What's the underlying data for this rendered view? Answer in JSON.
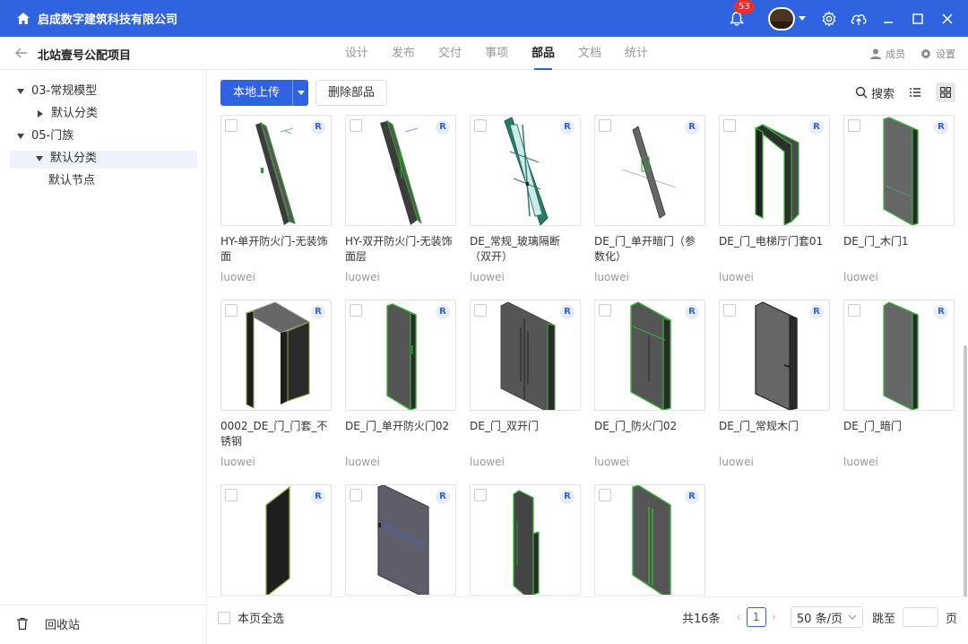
{
  "titlebar": {
    "app_title": "启成数字建筑科技有限公司",
    "notification_count": "53"
  },
  "nav": {
    "project_title": "北站壹号公配项目",
    "tabs": [
      {
        "label": "设计",
        "active": false
      },
      {
        "label": "发布",
        "active": false
      },
      {
        "label": "交付",
        "active": false
      },
      {
        "label": "事项",
        "active": false
      },
      {
        "label": "部品",
        "active": true
      },
      {
        "label": "文档",
        "active": false
      },
      {
        "label": "统计",
        "active": false
      }
    ],
    "members_label": "成员",
    "settings_label": "设置"
  },
  "sidebar": {
    "tree": [
      {
        "label": "03-常规模型",
        "level": 0,
        "expanded": true
      },
      {
        "label": "默认分类",
        "level": 1,
        "expanded": false
      },
      {
        "label": "05-门族",
        "level": 0,
        "expanded": true
      },
      {
        "label": "默认分类",
        "level": 1,
        "expanded": true,
        "selected": true
      },
      {
        "label": "默认节点",
        "level": 2
      }
    ],
    "recycle_label": "回收站"
  },
  "toolbar": {
    "upload_label": "本地上传",
    "delete_label": "删除部品",
    "search_label": "搜索"
  },
  "cards": [
    {
      "name": "HY-单开防火门-无装饰面",
      "author": "luowei",
      "badge": "R"
    },
    {
      "name": "HY-双开防火门-无装饰面层",
      "author": "luowei",
      "badge": "R"
    },
    {
      "name": "DE_常规_玻璃隔断（双开）",
      "author": "luowei",
      "badge": "R"
    },
    {
      "name": "DE_门_单开暗门（参数化）",
      "author": "luowei",
      "badge": "R"
    },
    {
      "name": "DE_门_电梯厅门套01",
      "author": "luowei",
      "badge": "R"
    },
    {
      "name": "DE_门_木门1",
      "author": "luowei",
      "badge": "R"
    },
    {
      "name": "0002_DE_门_门套_不锈钢",
      "author": "luowei",
      "badge": "R"
    },
    {
      "name": "DE_门_单开防火门02",
      "author": "luowei",
      "badge": "R"
    },
    {
      "name": "DE_门_双开门",
      "author": "luowei",
      "badge": "R"
    },
    {
      "name": "DE_门_防火门02",
      "author": "luowei",
      "badge": "R"
    },
    {
      "name": "DE_门_常规木门",
      "author": "luowei",
      "badge": "R"
    },
    {
      "name": "DE_门_暗门",
      "author": "luowei",
      "badge": "R"
    },
    {
      "name": "",
      "author": "",
      "badge": "R"
    },
    {
      "name": "",
      "author": "",
      "badge": "R"
    },
    {
      "name": "",
      "author": "",
      "badge": "R"
    },
    {
      "name": "",
      "author": "",
      "badge": "R"
    }
  ],
  "footer": {
    "select_all_label": "本页全选",
    "total_label": "共16条",
    "current_page": "1",
    "page_size_label": "50 条/页",
    "jump_label": "跳至",
    "page_unit": "页"
  },
  "colors": {
    "brand": "#2f63e0",
    "badge_red": "#e5312f"
  }
}
